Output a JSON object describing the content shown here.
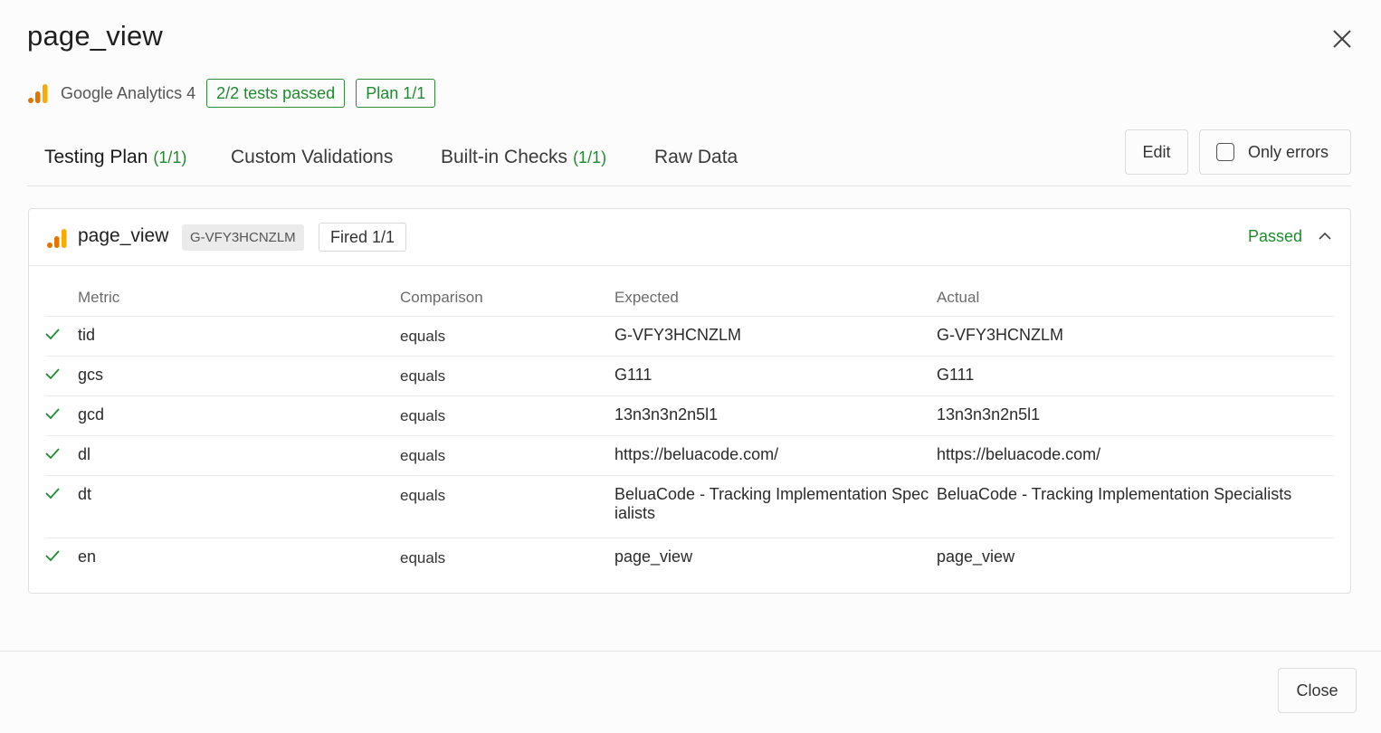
{
  "modal": {
    "title": "page_view"
  },
  "subheader": {
    "tool_icon": "google-analytics-bars-icon",
    "tool_name": "Google Analytics 4",
    "tests_badge": "2/2 tests passed",
    "plan_badge": "Plan 1/1"
  },
  "tabs": [
    {
      "label": "Testing Plan",
      "count": "(1/1)"
    },
    {
      "label": "Custom Validations",
      "count": ""
    },
    {
      "label": "Built-in Checks",
      "count": "(1/1)"
    },
    {
      "label": "Raw Data",
      "count": ""
    }
  ],
  "toolbar": {
    "edit_label": "Edit",
    "only_errors_label": "Only errors",
    "only_errors_checked": false
  },
  "event_card": {
    "title": "page_view",
    "measurement_id": "G-VFY3HCNZLM",
    "fired": "Fired 1/1",
    "status": "Passed",
    "expanded": true,
    "columns": [
      "Metric",
      "Comparison",
      "Expected",
      "Actual"
    ],
    "rows": [
      {
        "metric": "tid",
        "comparison": "equals",
        "expected": "G-VFY3HCNZLM",
        "actual": "G-VFY3HCNZLM",
        "passed": true
      },
      {
        "metric": "gcs",
        "comparison": "equals",
        "expected": "G111",
        "actual": "G111",
        "passed": true
      },
      {
        "metric": "gcd",
        "comparison": "equals",
        "expected": "13n3n3n2n5l1",
        "actual": "13n3n3n2n5l1",
        "passed": true
      },
      {
        "metric": "dl",
        "comparison": "equals",
        "expected": "https://beluacode.com/",
        "actual": "https://beluacode.com/",
        "passed": true
      },
      {
        "metric": "dt",
        "comparison": "equals",
        "expected": "BeluaCode - Tracking Implementation Specialists",
        "actual": "BeluaCode - Tracking Implementation Specialists",
        "passed": true
      },
      {
        "metric": "en",
        "comparison": "equals",
        "expected": "page_view",
        "actual": "page_view",
        "passed": true
      }
    ]
  },
  "footer": {
    "close_label": "Close"
  },
  "colors": {
    "success": "#1f8a2e",
    "ga_orange": "#f9ab00",
    "ga_dark_orange": "#e37400"
  }
}
